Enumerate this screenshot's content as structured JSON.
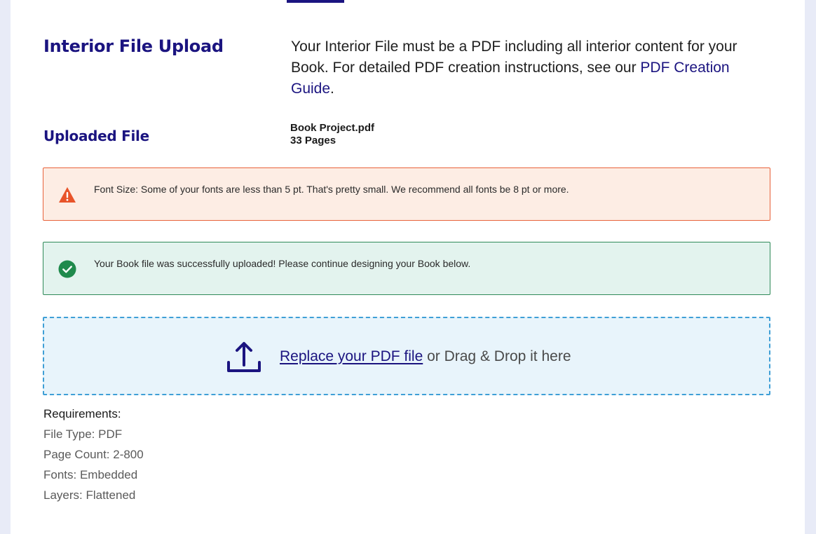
{
  "upload_section": {
    "title": "Interior File Upload",
    "intro_text": "Your Interior File must be a PDF including all interior content for your Book. For detailed PDF creation instructions, see our ",
    "guide_link": "PDF Creation Guide",
    "intro_end": "."
  },
  "uploaded_file": {
    "title": "Uploaded File",
    "file_name": "Book Project.pdf",
    "page_count": "33 Pages"
  },
  "warning_alert": {
    "icon": "warning-triangle-icon",
    "message": "Font Size: Some of your fonts are less than 5 pt. That's pretty small. We recommend all fonts be 8 pt or more.",
    "color": "#e8623a"
  },
  "success_alert": {
    "icon": "check-circle-icon",
    "message": "Your Book file was successfully uploaded! Please continue designing your Book below.",
    "color": "#2f8a58"
  },
  "dropzone": {
    "icon": "upload-icon",
    "link_label": "Replace your PDF file",
    "suffix": " or Drag & Drop it here"
  },
  "requirements": {
    "heading": "Requirements:",
    "items": [
      "File Type: PDF",
      "Page Count: 2-800",
      "Fonts: Embedded",
      "Layers: Flattened"
    ]
  },
  "colors": {
    "brand": "#1b1480",
    "page_background": "#e8ebf7",
    "dropzone_border": "#3f9fd6"
  }
}
